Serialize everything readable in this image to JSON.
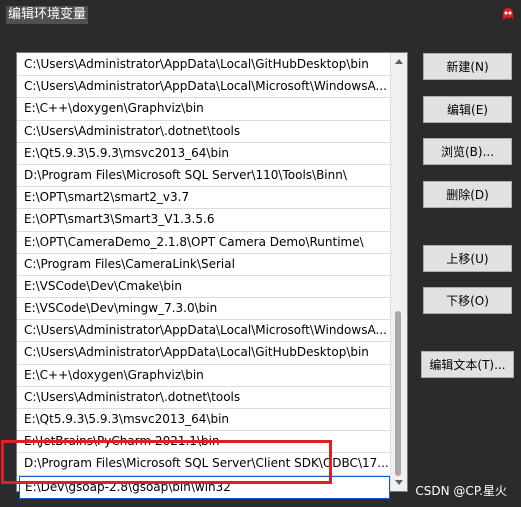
{
  "window": {
    "title": "编辑环境变量"
  },
  "path_entries": [
    "C:\\Users\\Administrator\\AppData\\Local\\GitHubDesktop\\bin",
    "C:\\Users\\Administrator\\AppData\\Local\\Microsoft\\WindowsA...",
    "E:\\C++\\doxygen\\Graphviz\\bin",
    "C:\\Users\\Administrator\\.dotnet\\tools",
    "E:\\Qt5.9.3\\5.9.3\\msvc2013_64\\bin",
    "D:\\Program Files\\Microsoft SQL Server\\110\\Tools\\Binn\\",
    "E:\\OPT\\smart2\\smart2_v3.7",
    "E:\\OPT\\smart3\\Smart3_V1.3.5.6",
    "E:\\OPT\\CameraDemo_2.1.8\\OPT Camera Demo\\Runtime\\",
    "C:\\Program Files\\CameraLink\\Serial",
    "E:\\VSCode\\Dev\\Cmake\\bin",
    "E:\\VSCode\\Dev\\mingw_7.3.0\\bin",
    "C:\\Users\\Administrator\\AppData\\Local\\Microsoft\\WindowsA...",
    "C:\\Users\\Administrator\\AppData\\Local\\GitHubDesktop\\bin",
    "E:\\C++\\doxygen\\Graphviz\\bin",
    "C:\\Users\\Administrator\\.dotnet\\tools",
    "E:\\Qt5.9.3\\5.9.3\\msvc2013_64\\bin",
    "E:\\JetBrains\\PyCharm 2021.1\\bin",
    "D:\\Program Files\\Microsoft SQL Server\\Client SDK\\ODBC\\17...",
    "E:\\Dev\\gsoap-2.8\\gsoap\\bin\\win32"
  ],
  "buttons": {
    "new": "新建(N)",
    "edit": "编辑(E)",
    "browse": "浏览(B)...",
    "delete": "删除(D)",
    "move_up": "上移(U)",
    "move_down": "下移(O)",
    "edit_text": "编辑文本(T)..."
  },
  "watermark": "CSDN @CP.星火",
  "colors": {
    "highlight_box": "#e02020",
    "background": "#2b2b2b"
  }
}
